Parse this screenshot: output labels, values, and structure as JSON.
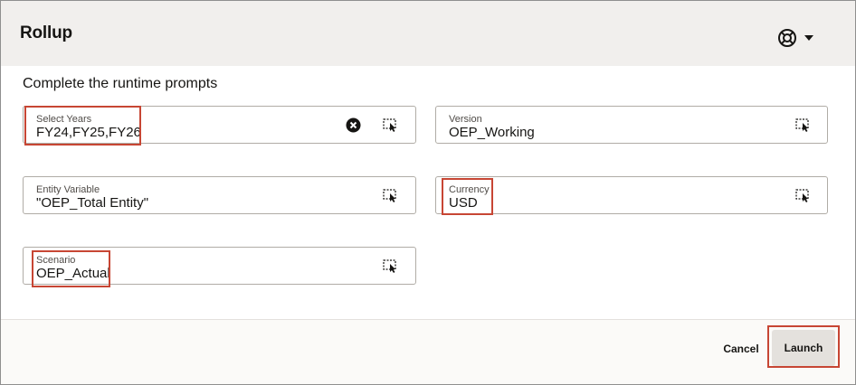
{
  "dialog": {
    "title": "Rollup",
    "help_icon": "lifebuoy-icon",
    "menu_icon": "caret-down-icon"
  },
  "instructions": "Complete the runtime prompts",
  "fields": {
    "select_years": {
      "label": "Select Years",
      "value": "FY24,FY25,FY26",
      "clear_icon": "clear-icon",
      "selector_icon": "member-selector-icon"
    },
    "version": {
      "label": "Version",
      "value": "OEP_Working",
      "selector_icon": "member-selector-icon"
    },
    "entity_variable": {
      "label": "Entity Variable",
      "value": "\"OEP_Total Entity\"",
      "selector_icon": "member-selector-icon"
    },
    "currency": {
      "label": "Currency",
      "value": "USD",
      "selector_icon": "member-selector-icon"
    },
    "scenario": {
      "label": "Scenario",
      "value": "OEP_Actual",
      "selector_icon": "member-selector-icon"
    }
  },
  "footer": {
    "cancel_label": "Cancel",
    "launch_label": "Launch"
  },
  "colors": {
    "header_bg": "#f1efed",
    "highlight": "#c74634",
    "launch_bg": "#e4e1dd",
    "text": "#161513"
  }
}
